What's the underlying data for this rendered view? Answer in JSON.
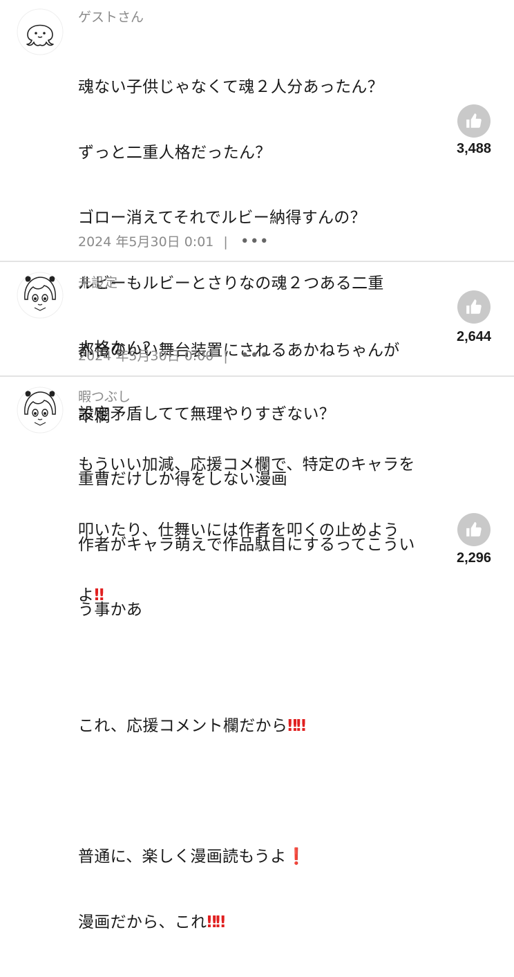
{
  "comments": [
    {
      "username": "ゲストさん",
      "avatar_icon": "octopus-avatar-icon",
      "lines": [
        "魂ない子供じゃなくて魂２人分あったん？",
        "ずっと二重人格だったん？",
        "ゴロー消えてそれでルビー納得すんの？",
        "ルビーもルビーとさりなの魂２つある二重",
        "人格なん？",
        "設定矛盾してて無理やりすぎない？",
        "重曹だけしか得をしない漫画",
        "作者がキャラ萌えで作品駄目にするってこうい",
        "う事かあ"
      ],
      "timestamp": "2024 年5月30日 0:01",
      "separator": "|",
      "more_label": "•••",
      "likes": "3,488"
    },
    {
      "username": "未設定",
      "avatar_icon": "anime-girl-avatar-icon",
      "lines": [
        "都合のいい舞台装置にされるあかねちゃんが",
        "不憫"
      ],
      "timestamp": "2024 年5月30日 0:00",
      "separator": "|",
      "more_label": "•••",
      "likes": "2,644"
    },
    {
      "username": "暇つぶし",
      "avatar_icon": "anime-girl-avatar-icon",
      "lines": [
        "もういい加減、応援コメ欄で、特定のキャラを",
        "叩いたり、仕舞いには作者を叩くの止めよう",
        "よ‼︎",
        "",
        "これ、応援コメント欄だから‼︎‼︎",
        "",
        "普通に、楽しく漫画読もうよ❗",
        "漫画だから、これ‼︎‼︎"
      ],
      "emphasis_marks": {
        "double_exclamation": "‼",
        "single_exclamation": "❗"
      },
      "likes": "2,296"
    }
  ],
  "colors": {
    "meta_text": "#8a8a8a",
    "like_button_bg": "#c9c9c9",
    "emphasis": "#e02020",
    "divider": "#e3e3e3"
  }
}
